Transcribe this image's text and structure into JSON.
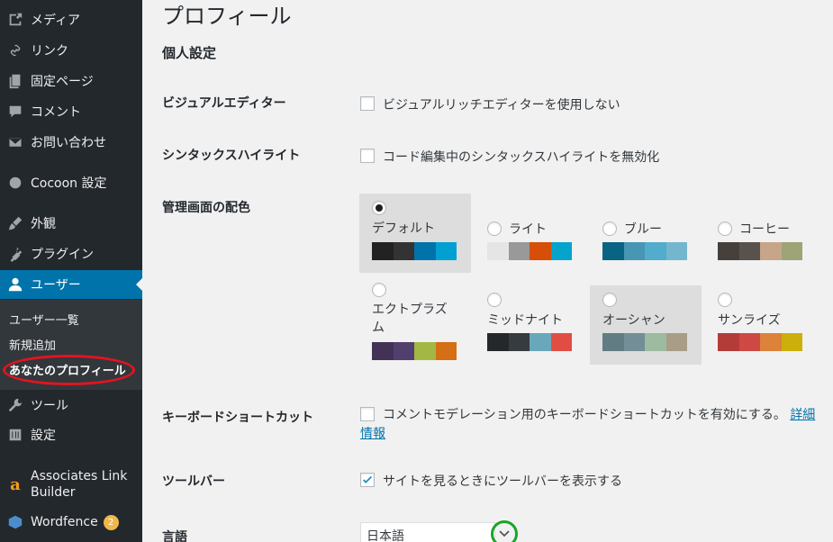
{
  "sidebar": {
    "items": [
      {
        "label": "メディア",
        "icon": "media-icon"
      },
      {
        "label": "リンク",
        "icon": "link-icon"
      },
      {
        "label": "固定ページ",
        "icon": "page-icon"
      },
      {
        "label": "コメント",
        "icon": "comment-icon"
      },
      {
        "label": "お問い合わせ",
        "icon": "mail-icon"
      },
      {
        "label": "Cocoon 設定",
        "icon": "circle-icon"
      },
      {
        "label": "外観",
        "icon": "brush-icon"
      },
      {
        "label": "プラグイン",
        "icon": "plugin-icon"
      },
      {
        "label": "ユーザー",
        "icon": "user-icon"
      },
      {
        "label": "ツール",
        "icon": "wrench-icon"
      },
      {
        "label": "設定",
        "icon": "settings-icon"
      },
      {
        "label": "Associates Link Builder",
        "icon": "amazon-icon"
      },
      {
        "label": "Wordfence",
        "icon": "wordfence-icon",
        "badge": "2"
      }
    ],
    "submenu": [
      "ユーザー一覧",
      "新規追加",
      "あなたのプロフィール"
    ]
  },
  "page": {
    "title": "プロフィール",
    "section": "個人設定",
    "visual_editor": {
      "label": "ビジュアルエディター",
      "option": "ビジュアルリッチエディターを使用しない"
    },
    "syntax": {
      "label": "シンタックスハイライト",
      "option": "コード編集中のシンタックスハイライトを無効化"
    },
    "admin_color": {
      "label": "管理画面の配色",
      "schemes": [
        {
          "name": "デフォルト",
          "colors": [
            "#222222",
            "#333333",
            "#0073aa",
            "#00a0d2"
          ]
        },
        {
          "name": "ライト",
          "colors": [
            "#e5e5e5",
            "#999999",
            "#d64e07",
            "#04a4cc"
          ]
        },
        {
          "name": "ブルー",
          "colors": [
            "#096484",
            "#4796b3",
            "#52accc",
            "#74b6ce"
          ]
        },
        {
          "name": "コーヒー",
          "colors": [
            "#46403c",
            "#59524c",
            "#c7a589",
            "#9ea476"
          ]
        },
        {
          "name": "エクトプラズム",
          "colors": [
            "#413256",
            "#523f6d",
            "#a3b745",
            "#d46f15"
          ]
        },
        {
          "name": "ミッドナイト",
          "colors": [
            "#25282b",
            "#363b3f",
            "#69a8bb",
            "#e14d43"
          ]
        },
        {
          "name": "オーシャン",
          "colors": [
            "#627c83",
            "#738e96",
            "#9ebaa0",
            "#aa9d88"
          ]
        },
        {
          "name": "サンライズ",
          "colors": [
            "#b43c38",
            "#cf4944",
            "#dd823b",
            "#ccaf0b"
          ]
        }
      ]
    },
    "keyboard": {
      "label": "キーボードショートカット",
      "option": "コメントモデレーション用のキーボードショートカットを有効にする。",
      "link1": "詳細",
      "link2": "情報"
    },
    "toolbar": {
      "label": "ツールバー",
      "option": "サイトを見るときにツールバーを表示する"
    },
    "language": {
      "label": "言語",
      "value": "日本語"
    }
  },
  "colors": {
    "sidebar": "#23282d",
    "active": "#0073aa",
    "highlight_red": "#e3141f",
    "highlight_green": "#1aa526"
  }
}
